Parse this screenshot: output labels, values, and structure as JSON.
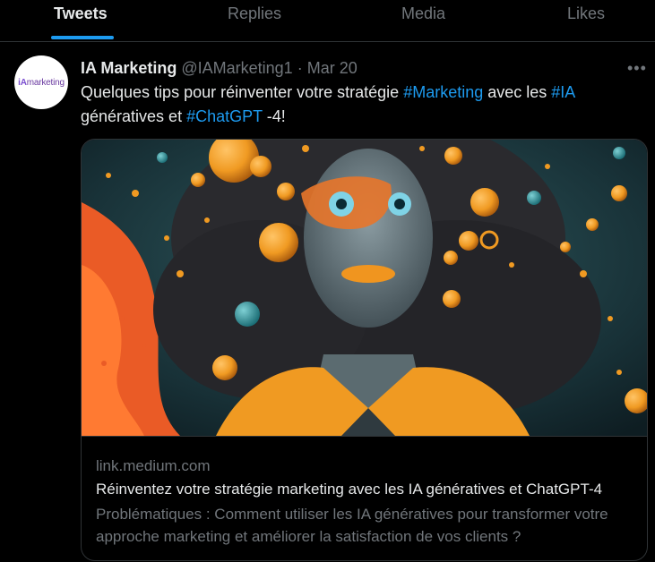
{
  "tabs": [
    {
      "label": "Tweets",
      "active": true
    },
    {
      "label": "Replies",
      "active": false
    },
    {
      "label": "Media",
      "active": false
    },
    {
      "label": "Likes",
      "active": false
    }
  ],
  "tweet": {
    "avatar_text": {
      "prefix": "iA",
      "suffix": "marketing"
    },
    "author_name": "IA Marketing",
    "handle": "@IAMarketing1",
    "separator": "·",
    "date": "Mar 20",
    "more_icon": "more-horizontal-icon",
    "text_parts": [
      {
        "text": "Quelques tips pour réinventer votre stratégie ",
        "hashtag": false
      },
      {
        "text": "#Marketing",
        "hashtag": true
      },
      {
        "text": "  avec les ",
        "hashtag": false
      },
      {
        "text": "#IA",
        "hashtag": true
      },
      {
        "text": " génératives et ",
        "hashtag": false
      },
      {
        "text": "#ChatGPT",
        "hashtag": true
      },
      {
        "text": " -4!",
        "hashtag": false
      }
    ]
  },
  "card": {
    "domain": "link.medium.com",
    "title": "Réinventez votre stratégie marketing avec les IA génératives et ChatGPT-4",
    "description": "Problématiques :  Comment utiliser les IA génératives pour transformer votre approche marketing et améliorer la satisfaction de vos clients ?"
  },
  "colors": {
    "background": "#000000",
    "accent": "#1d9bf0",
    "text_primary": "#e7e9ea",
    "text_secondary": "#71767b",
    "border": "#2f3336"
  }
}
